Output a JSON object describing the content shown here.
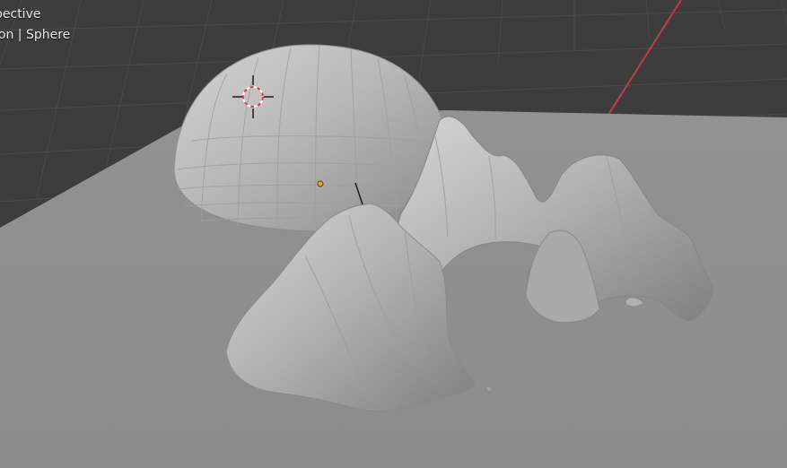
{
  "viewport": {
    "header_line_1": "pective",
    "header_line_2": "ion | Sphere"
  },
  "scene": {
    "background_color": "#3d3d3d",
    "grid_color": "#4a4a4a",
    "axis_color": "#c2394f",
    "ground_color": "#8f8f8f",
    "object_color": "#b5b5b5",
    "origin_color": "#ff9b26",
    "cursor_color": "#d73b50"
  }
}
